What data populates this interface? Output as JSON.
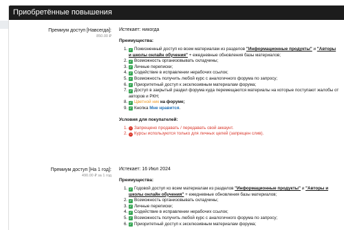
{
  "header": {
    "title": "Приобретённые повышения"
  },
  "subscriptions": [
    {
      "title": "Премиум доступ [Навсегда]:",
      "price": "850.00 ₽",
      "expires": "Истекает: никогда",
      "features_title": "Преимущества:",
      "features": {
        "f1_pre": "Пожизненный доступ ко всем материалам из разделов ",
        "f1_link1": "\"Информационные продукты\"",
        "f1_mid": " и ",
        "f1_link2": "\"Авторы и школы онлайн обучения\"",
        "f1_post": " + ежедневные обновления базы материалов;",
        "f2": "Возможность организовывать складчины;",
        "f3": "Личные переписки;",
        "f4": "Содействие в исправлении нерабочих ссылок;",
        "f5": "Возможность получить любой курс с аналогичного форума по запросу;",
        "f6": "Приоритетный доступ к эксклюзивным материалам форума;",
        "f7": "Доступ в закрытый раздел форума куда перемещаются материалы на которые поступают жалобы от авторов и РКН;",
        "f8_colored": "Цветной ник",
        "f8_post": " на форуме;",
        "f9_pre": "Кнопка ",
        "f9_colored": "Мне нравится",
        "f9_post": "."
      },
      "conditions_title": "Условия для покупателей:",
      "conditions": [
        "Запрещено продавать / передавать свой аккаунт.",
        "Курсы используются только для личных целей (запрещен слив)."
      ]
    },
    {
      "title": "Премиум доступ [На 1 год]:",
      "price": "490.00 ₽ за 1 год",
      "expires": "Истекает: 16 Июл 2024",
      "features_title": "Преимущества:",
      "features": {
        "f1_pre": "Годовой доступ ко всем материалам из разделов ",
        "f1_link1": "\"Информационные продукты\"",
        "f1_mid": " и ",
        "f1_link2": "\"Авторы и школы онлайн обучения\"",
        "f1_post": " + ежедневные обновления базы материалов;",
        "f2": "Возможность организовывать складчины;",
        "f3": "Личные переписки;",
        "f4": "Содействие в исправлении нерабочих ссылок;",
        "f5": "Возможность получить любой курс с аналогичного форума по запросу;",
        "f6": "Приоритетный доступ к эксклюзивным материалам форума;"
      }
    }
  ],
  "colors": {
    "header_bg": "#1c1c1c",
    "check": "#3aa757",
    "forbid": "#d9372b",
    "nick": "#e8951f",
    "like": "#1f6fb5"
  },
  "icons": {
    "check": "check-icon",
    "forbid": "no-entry-icon"
  }
}
